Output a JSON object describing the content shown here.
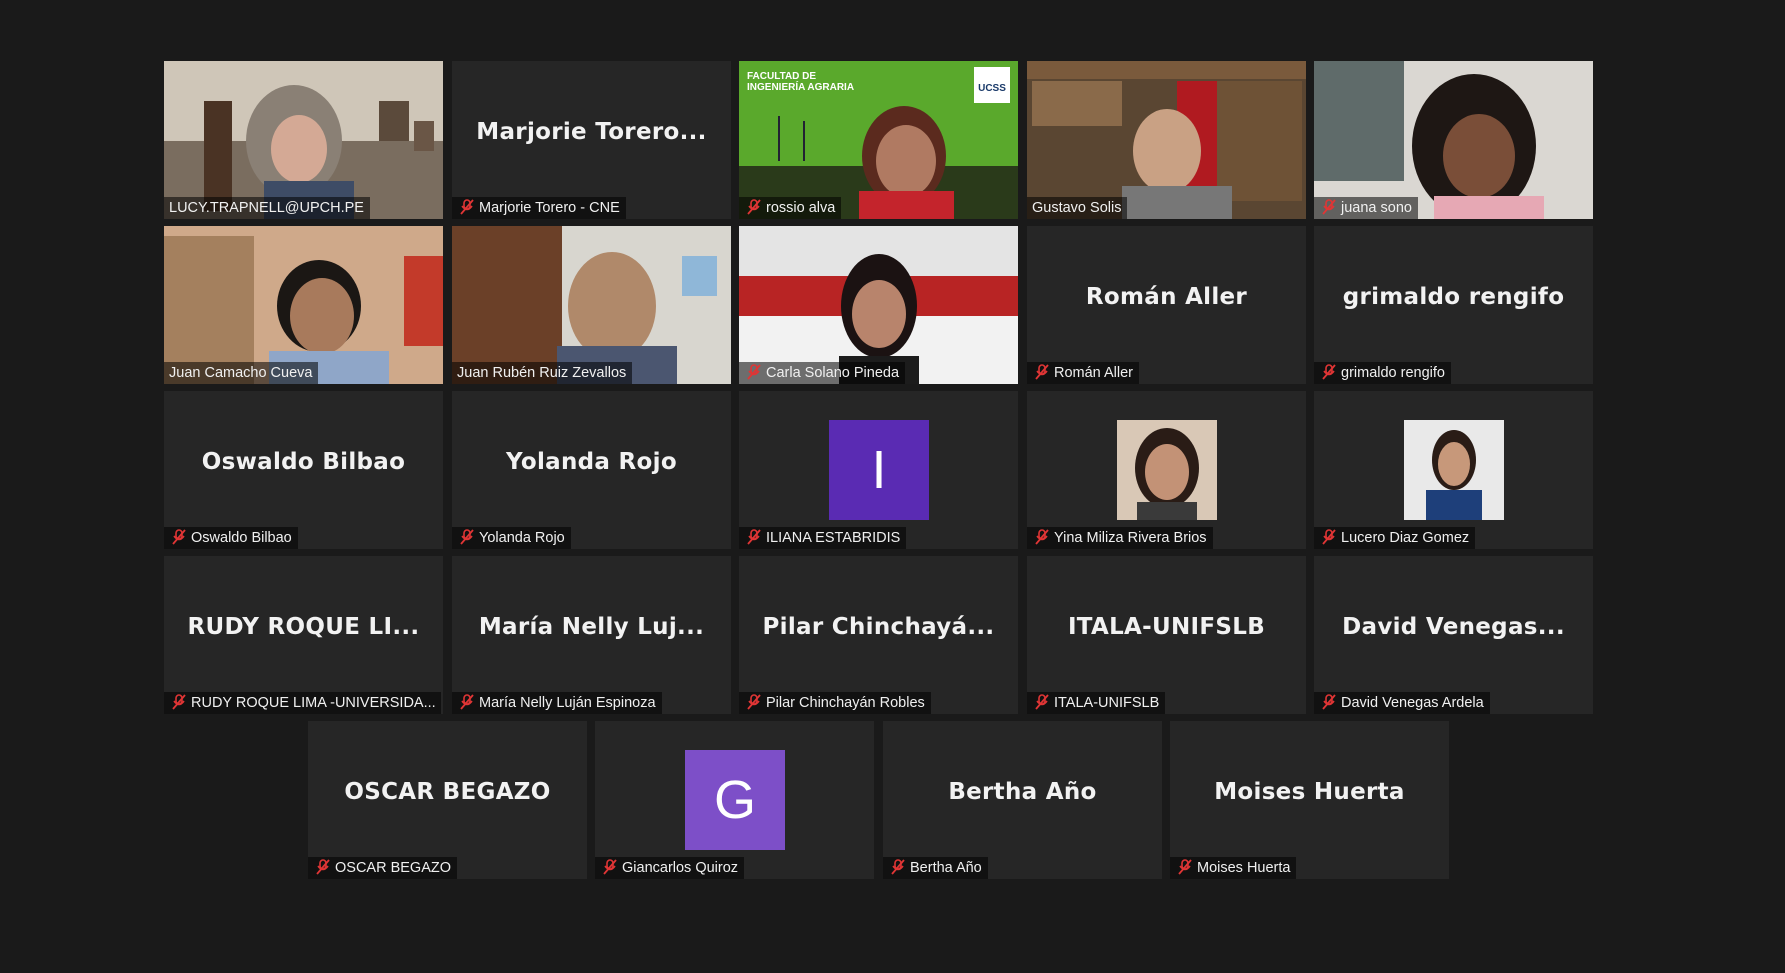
{
  "colors": {
    "background": "#1a1a1a",
    "tile": "#262626",
    "active_border": "#e9e876",
    "avatar_dark_purple": "#5a2bb3",
    "avatar_light_purple": "#7d4fc8",
    "muted_icon": "#e03535"
  },
  "participants": [
    {
      "id": "lucy",
      "label": "LUCY.TRAPNELL@UPCH.PE",
      "muted": false,
      "video": "photo"
    },
    {
      "id": "marjorie",
      "label": "Marjorie Torero - CNE",
      "muted": true,
      "display_name": "Marjorie  Torero..."
    },
    {
      "id": "rossio",
      "label": "rossio alva",
      "muted": true,
      "video": "photo",
      "banner_line1": "FACULTAD DE",
      "banner_line2": "INGENIERÍA AGRARIA",
      "banner_logo": "UCSS"
    },
    {
      "id": "gustavo",
      "label": "Gustavo Solis",
      "muted": false,
      "video": "photo"
    },
    {
      "id": "juana",
      "label": "juana sono",
      "muted": true,
      "video": "photo"
    },
    {
      "id": "juancamacho",
      "label": "Juan Camacho Cueva",
      "muted": false,
      "video": "photo"
    },
    {
      "id": "juanruben",
      "label": "Juan Rubén Ruiz Zevallos",
      "muted": false,
      "video": "photo",
      "active_speaker": true
    },
    {
      "id": "carla",
      "label": "Carla Solano Pineda",
      "muted": true,
      "video": "photo"
    },
    {
      "id": "roman",
      "label": "Román Aller",
      "muted": true,
      "display_name": "Román Aller"
    },
    {
      "id": "grimaldo",
      "label": "grimaldo rengifo",
      "muted": true,
      "display_name": "grimaldo rengifo"
    },
    {
      "id": "oswaldo",
      "label": "Oswaldo Bilbao",
      "muted": true,
      "display_name": "Oswaldo Bilbao"
    },
    {
      "id": "yolanda",
      "label": "Yolanda Rojo",
      "muted": true,
      "display_name": "Yolanda Rojo"
    },
    {
      "id": "iliana",
      "label": "ILIANA ESTABRIDIS",
      "muted": true,
      "avatar_letter": "I"
    },
    {
      "id": "yina",
      "label": "Yina Miliza Rivera Brios",
      "muted": true,
      "video": "thumb"
    },
    {
      "id": "lucero",
      "label": "Lucero Diaz Gomez",
      "muted": true,
      "video": "thumb"
    },
    {
      "id": "rudy",
      "label": "RUDY ROQUE LIMA -UNIVERSIDA...",
      "muted": true,
      "display_name": "RUDY  ROQUE  LI..."
    },
    {
      "id": "maria",
      "label": "María Nelly Luján Espinoza",
      "muted": true,
      "display_name": "María  Nelly  Luj..."
    },
    {
      "id": "pilar",
      "label": "Pilar Chinchayán Robles",
      "muted": true,
      "display_name": "Pilar  Chinchayá..."
    },
    {
      "id": "itala",
      "label": "ITALA-UNIFSLB",
      "muted": true,
      "display_name": "ITALA-UNIFSLB"
    },
    {
      "id": "david",
      "label": "David Venegas Ardela",
      "muted": true,
      "display_name": "David  Venegas..."
    },
    {
      "id": "oscar",
      "label": "OSCAR BEGAZO",
      "muted": true,
      "display_name": "OSCAR BEGAZO"
    },
    {
      "id": "giancarlos",
      "label": "Giancarlos Quiroz",
      "muted": true,
      "avatar_letter": "G"
    },
    {
      "id": "bertha",
      "label": "Bertha Año",
      "muted": true,
      "display_name": "Bertha Año"
    },
    {
      "id": "moises",
      "label": "Moises Huerta",
      "muted": true,
      "display_name": "Moises Huerta"
    }
  ]
}
